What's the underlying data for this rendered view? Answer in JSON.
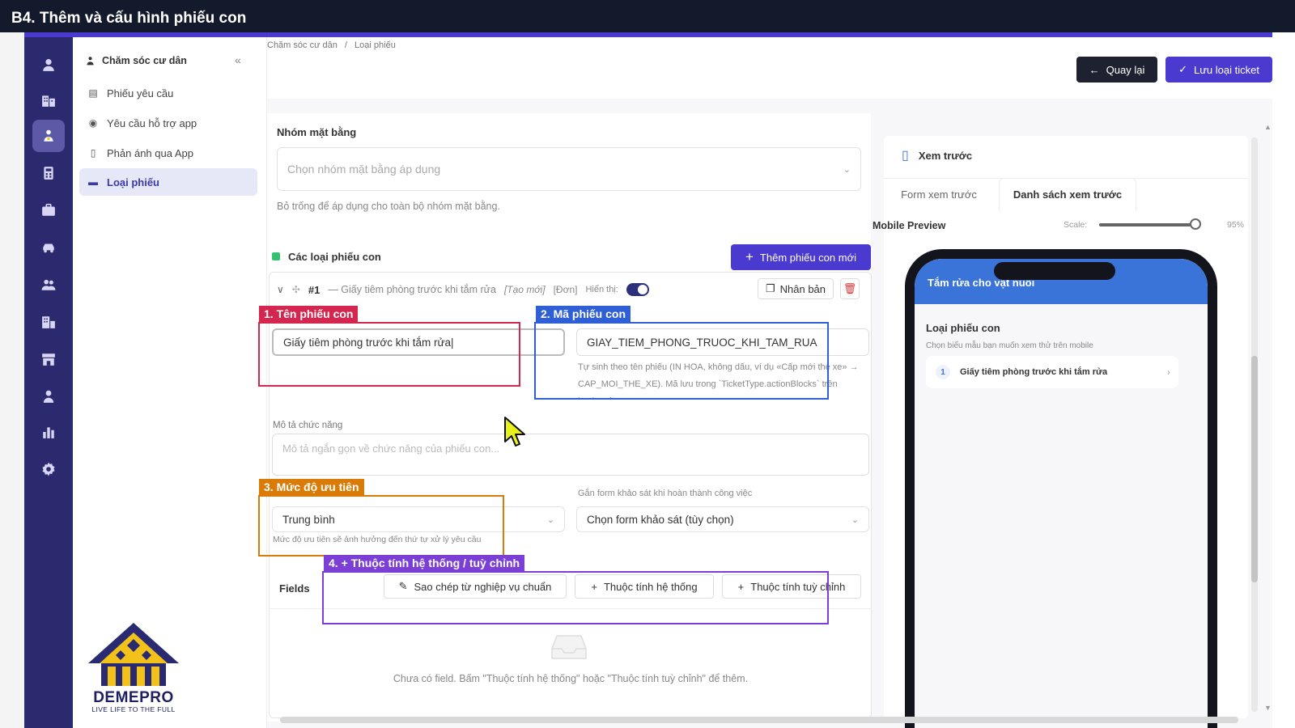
{
  "window": {
    "title": "B4. Thêm và cấu hình phiếu con"
  },
  "colors": {
    "topbar": "#131a2b",
    "accent": "#4a3ad0",
    "rail": "#2c2a6e",
    "anno_red": "#d4264e",
    "anno_blue": "#2f5fd6",
    "anno_orange": "#d97b06",
    "anno_purple": "#7b3fd6"
  },
  "rail": {
    "icons": [
      "user-icon",
      "building-icon",
      "resident-care-icon",
      "calculator-icon",
      "briefcase-icon",
      "car-icon",
      "users-icon",
      "apartment-icon",
      "store-icon",
      "person-icon",
      "chart-icon",
      "gear-icon"
    ],
    "active_index": 2
  },
  "sidenav": {
    "header": "Chăm sóc cư dân",
    "collapse_glyph": "«",
    "items": [
      {
        "label": "Phiếu yêu cầu",
        "icon": "ticket-icon"
      },
      {
        "label": "Yêu cầu hỗ trợ app",
        "icon": "support-icon"
      },
      {
        "label": "Phản ánh qua App",
        "icon": "phone-icon"
      },
      {
        "label": "Loại phiếu",
        "icon": "card-icon",
        "active": true
      }
    ]
  },
  "breadcrumb": {
    "items": [
      "Chăm sóc cư dân",
      "Loại phiếu"
    ],
    "separator": "/"
  },
  "actions": {
    "back_label": "Quay lại",
    "save_label": "Lưu loại ticket"
  },
  "form": {
    "group_label": "Nhóm mặt bằng",
    "group_placeholder": "Chọn nhóm mặt bằng áp dụng",
    "group_hint": "Bỏ trống để áp dụng cho toàn bộ nhóm mặt bằng.",
    "subtypes_label": "Các loại phiếu con",
    "add_subtype_label": "Thêm phiếu con mới"
  },
  "subtype": {
    "index": "#1",
    "title": "— Giấy tiêm phòng trước khi tắm rửa",
    "tag_new": "[Tạo mới]",
    "tag_single": "[Đơn]",
    "visible_label": "Hiển thị:",
    "visible": true,
    "duplicate_label": "Nhân bản",
    "name_value": "Giấy tiêm phòng trước khi tắm rửa",
    "code_value": "GIAY_TIEM_PHONG_TRUOC_KHI_TAM_RUA",
    "code_hint": "Tự sinh theo tên phiếu (IN HOA, không dấu, ví dụ «Cấp mới thẻ xe» → CAP_MOI_THE_XE). Mã lưu trong `TicketType.actionBlocks` trên backend.",
    "desc_label": "Mô tả chức năng",
    "desc_placeholder": "Mô tả ngắn gọn về chức năng của phiếu con...",
    "priority_value": "Trung bình",
    "priority_hint": "Mức độ ưu tiên sẽ ảnh hưởng đến thứ tự xử lý yêu cầu",
    "survey_label": "Gắn form khảo sát khi hoàn thành công việc",
    "survey_value": "Chọn form khảo sát (tùy chọn)",
    "fields_label": "Fields",
    "copy_btn": "Sao chép từ nghiệp vụ chuẩn",
    "system_btn": "Thuộc tính hệ thống",
    "custom_btn": "Thuộc tính tuỳ chỉnh",
    "empty_text": "Chưa có field. Bấm \"Thuộc tính hệ thống\" hoặc \"Thuộc tính tuỳ chỉnh\" để thêm."
  },
  "annotations": [
    {
      "label": "1. Tên phiếu con"
    },
    {
      "label": "2. Mã phiếu con"
    },
    {
      "label": "3. Mức độ ưu tiên"
    },
    {
      "label": "4. + Thuộc tính hệ thống / tuỳ chỉnh"
    }
  ],
  "preview": {
    "title": "Xem trước",
    "tabs": [
      "Form xem trước",
      "Danh sách xem trước"
    ],
    "active_tab": 1,
    "mobile_label": "Mobile Preview",
    "scale_label": "Scale:",
    "scale_value": "95%",
    "scale_fraction": 0.95,
    "phone_title": "Tắm rửa cho vật nuôi",
    "list_title": "Loại phiếu con",
    "list_hint": "Chọn biểu mẫu bạn muốn xem thử trên mobile",
    "item_index": "1",
    "item_label": "Giấy tiêm phòng trước khi tắm rửa",
    "item_arrow": "›"
  },
  "logo": {
    "name": "DEMEPRO",
    "tagline": "LIVE LIFE TO THE FULL"
  }
}
